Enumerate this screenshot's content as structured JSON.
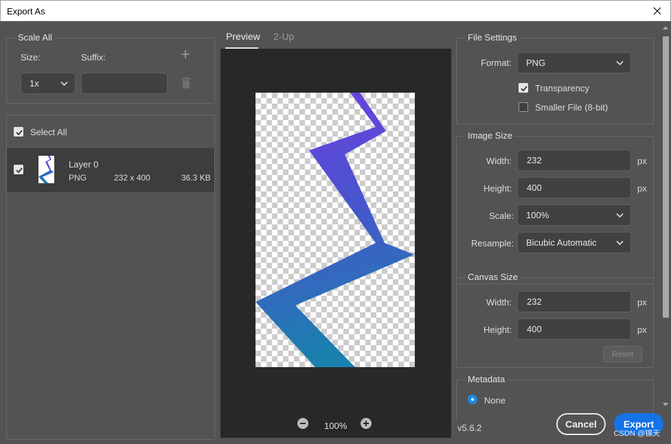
{
  "window": {
    "title": "Export As"
  },
  "scale_all": {
    "label": "Scale All",
    "size_label": "Size:",
    "suffix_label": "Suffix:",
    "size_value": "1x",
    "suffix_value": "",
    "icons": [
      "plus-icon",
      "trash-icon"
    ]
  },
  "layers": {
    "select_all_label": "Select All",
    "select_all_checked": true,
    "items": [
      {
        "name": "Layer 0",
        "format": "PNG",
        "dimensions": "232 x 400",
        "size": "36.3 KB",
        "checked": true
      }
    ]
  },
  "preview": {
    "tabs": [
      {
        "label": "Preview",
        "active": true
      },
      {
        "label": "2-Up",
        "active": false
      }
    ],
    "zoom": "100%"
  },
  "file_settings": {
    "label": "File Settings",
    "format_label": "Format:",
    "format_value": "PNG",
    "transparency_label": "Transparency",
    "transparency_checked": true,
    "smaller_file_label": "Smaller File (8-bit)",
    "smaller_file_checked": false
  },
  "image_size": {
    "label": "Image Size",
    "width_label": "Width:",
    "width_value": "232",
    "height_label": "Height:",
    "height_value": "400",
    "scale_label": "Scale:",
    "scale_value": "100%",
    "resample_label": "Resample:",
    "resample_value": "Bicubic Automatic",
    "unit": "px"
  },
  "canvas_size": {
    "label": "Canvas Size",
    "width_label": "Width:",
    "width_value": "232",
    "height_label": "Height:",
    "height_value": "400",
    "unit": "px",
    "reset_label": "Reset"
  },
  "metadata": {
    "label": "Metadata",
    "option_label": "None",
    "option_selected": true
  },
  "footer": {
    "version": "v5.6.2",
    "cancel_label": "Cancel",
    "export_label": "Export",
    "watermark": "CSDN @锦天"
  },
  "colors": {
    "bg": "#535353",
    "preview_bg": "#282828",
    "accent_blue": "#1473e6",
    "shape_top": "#6b3fe0",
    "shape_bottom": "#1b7fb0"
  }
}
